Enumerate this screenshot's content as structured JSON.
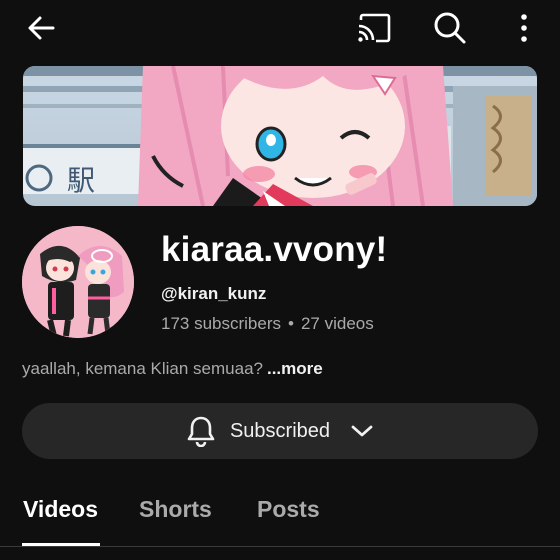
{
  "topbar": {
    "icons": [
      "back-arrow-icon",
      "cast-icon",
      "search-icon",
      "more-vert-icon"
    ]
  },
  "channel": {
    "name": "kiaraa.vvony!",
    "handle": "@kiran_kunz",
    "subscribers": "173 subscribers",
    "separator": "•",
    "videos": "27 videos",
    "description": "yaallah, kemana Klian semuaa?",
    "more_label": "...more",
    "banner_sign_text": "駅"
  },
  "subscribe": {
    "label": "Subscribed",
    "icons": [
      "bell-icon",
      "chevron-down-icon"
    ]
  },
  "tabs": [
    {
      "label": "Videos",
      "active": true
    },
    {
      "label": "Shorts",
      "active": false
    },
    {
      "label": "Posts",
      "active": false
    }
  ],
  "colors": {
    "background": "#0f0f0f",
    "button_bg": "#272727",
    "secondary_text": "#aaaaaa",
    "avatar_bg": "#f4b8c8"
  }
}
